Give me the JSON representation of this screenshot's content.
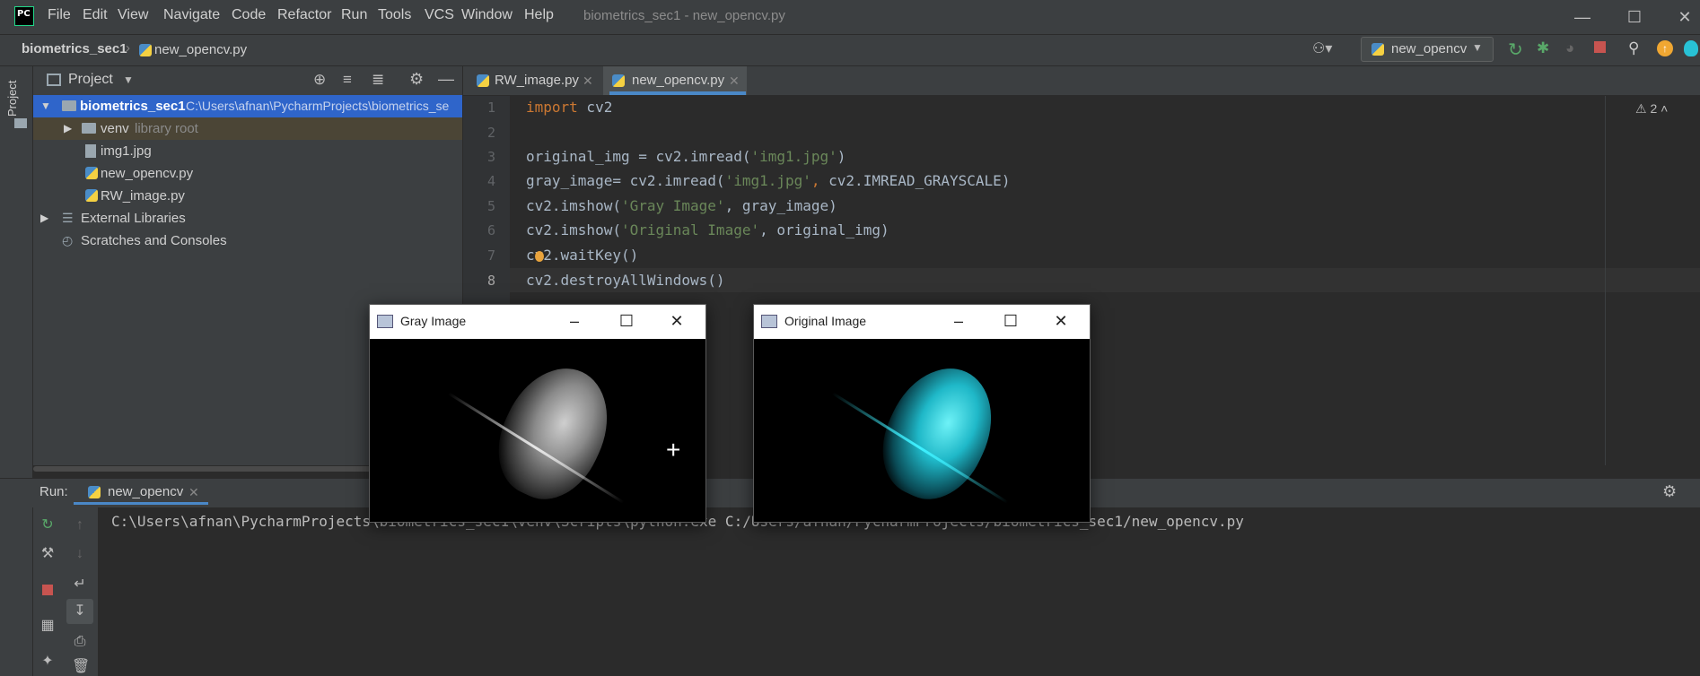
{
  "titlebar": {
    "menu": [
      "File",
      "Edit",
      "View",
      "Navigate",
      "Code",
      "Refactor",
      "Run",
      "Tools",
      "VCS",
      "Window",
      "Help"
    ],
    "window_title": "biometrics_sec1 - new_opencv.py"
  },
  "navbar": {
    "project": "biometrics_sec1",
    "file": "new_opencv.py",
    "run_config": "new_opencv"
  },
  "project_panel": {
    "strip_label": "Project",
    "title": "Project",
    "tree": [
      {
        "label": "biometrics_sec1",
        "hint": "C:\\Users\\afnan\\PycharmProjects\\biometrics_se"
      },
      {
        "label": "venv",
        "hint": "library root"
      },
      {
        "label": "img1.jpg"
      },
      {
        "label": "new_opencv.py"
      },
      {
        "label": "RW_image.py"
      },
      {
        "label": "External Libraries"
      },
      {
        "label": "Scratches and Consoles"
      }
    ]
  },
  "editor": {
    "tabs": [
      {
        "label": "RW_image.py"
      },
      {
        "label": "new_opencv.py",
        "active": true
      }
    ],
    "line_numbers": [
      "1",
      "2",
      "3",
      "4",
      "5",
      "6",
      "7",
      "8"
    ],
    "code": {
      "l1_kw": "import",
      "l1_rest": " cv2",
      "l3_a": "original_img = cv2.imread(",
      "l3_s": "'img1.jpg'",
      "l3_b": ")",
      "l4_a": "gray_image= cv2.imread(",
      "l4_s": "'img1.jpg'",
      "l4_c": ", ",
      "l4_b": "cv2.IMREAD_GRAYSCALE)",
      "l5_a": "cv2.imshow(",
      "l5_s": "'Gray Image'",
      "l5_b": ", gray_image)",
      "l6_a": "cv2.imshow(",
      "l6_s": "'Original Image'",
      "l6_b": ", original_img)",
      "l7": "cv2.waitKey()",
      "l8": "cv2.destroyAllWindows()"
    },
    "warnings": "2"
  },
  "run_panel": {
    "label": "Run:",
    "tab": "new_opencv",
    "console": "C:\\Users\\afnan\\PycharmProjects\\biometrics_sec1\\venv\\Scripts\\python.exe C:/Users/afnan/PycharmProjects/biometrics_sec1/new_opencv.py"
  },
  "windows": {
    "gray": {
      "title": "Gray Image"
    },
    "original": {
      "title": "Original Image"
    }
  },
  "colors": {
    "accent": "#2f65ca",
    "tab_underline": "#4a88c7",
    "fingerprint_color": "#29d6e0"
  }
}
